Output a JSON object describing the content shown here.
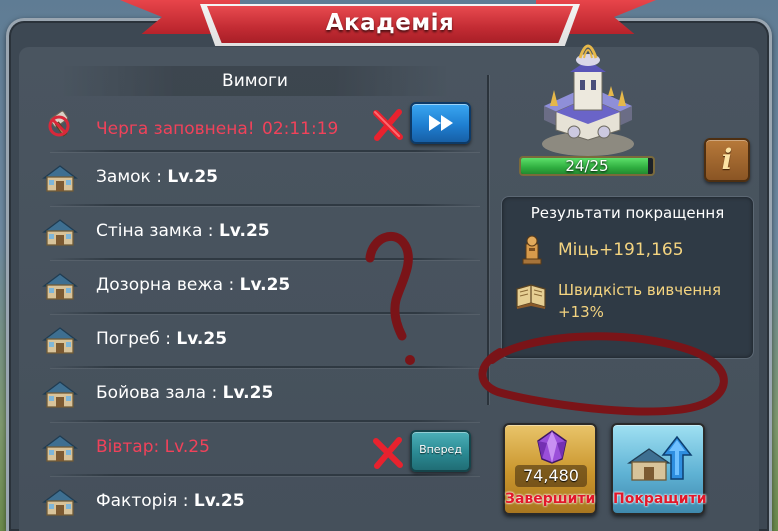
{
  "window": {
    "title": "Академія"
  },
  "requirements": {
    "heading": "Вимоги",
    "queue": {
      "label": "Черга заповнена!",
      "timer": "02:11:19"
    },
    "items": [
      {
        "name": "Замок",
        "sep": " : ",
        "level": "Lv.25",
        "met": true
      },
      {
        "name": "Стіна замка",
        "sep": " : ",
        "level": "Lv.25",
        "met": true
      },
      {
        "name": "Дозорна вежа",
        "sep": " : ",
        "level": "Lv.25",
        "met": true
      },
      {
        "name": "Погреб",
        "sep": " : ",
        "level": "Lv.25",
        "met": true
      },
      {
        "name": "Бойова зала",
        "sep": " : ",
        "level": "Lv.25",
        "met": true
      },
      {
        "name": "Вівтар",
        "sep": ": ",
        "level": "Lv.25",
        "met": false
      },
      {
        "name": "Факторія",
        "sep": " : ",
        "level": "Lv.25",
        "met": true
      }
    ],
    "next_button": "Вперед"
  },
  "building": {
    "progress_text": "24/25",
    "progress_fraction": 0.96,
    "info_label": "i"
  },
  "results": {
    "title": "Результати покращення",
    "power": "Міць+191,165",
    "speed_line1": "Швидкість вивчення",
    "speed_line2": "+13%"
  },
  "actions": {
    "finish": {
      "cost": "74,480",
      "label": "Завершити"
    },
    "upgrade": {
      "label": "Покращити"
    }
  },
  "colors": {
    "warning_text": "#f0425a",
    "result_text": "#f4d480",
    "progress_fill": "#2fae3f",
    "annotation": "#7a1418"
  },
  "icons": {
    "queue": "prohibited-hammer-icon",
    "building": "house-icon",
    "cancel": "red-x-icon",
    "speedup": "fast-forward-icon",
    "power": "power-statue-icon",
    "speed": "book-icon",
    "gem": "purple-gem-icon",
    "upgrade": "upgrade-arrow-icon"
  }
}
